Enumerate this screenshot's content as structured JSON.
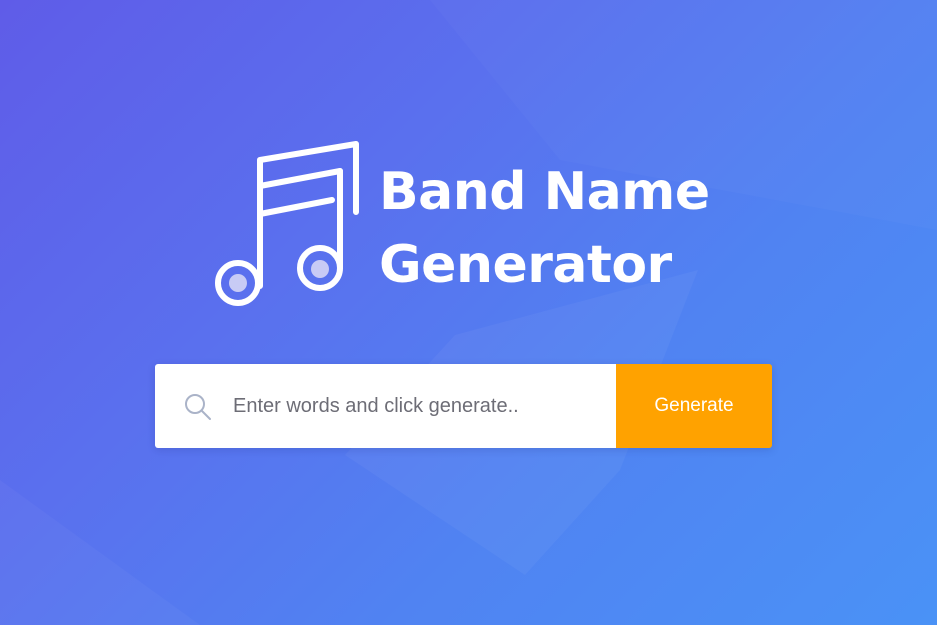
{
  "hero": {
    "title_line1": "Band Name",
    "title_line2": "Generator",
    "logo_icon": "music-notes-icon"
  },
  "search": {
    "icon": "search-icon",
    "placeholder": "Enter words and click generate..",
    "value": ""
  },
  "actions": {
    "generate_label": "Generate"
  },
  "colors": {
    "background_start": "#5f5ce8",
    "background_end": "#4a92f6",
    "accent_button": "#ffa200",
    "text_primary": "#ffffff"
  }
}
